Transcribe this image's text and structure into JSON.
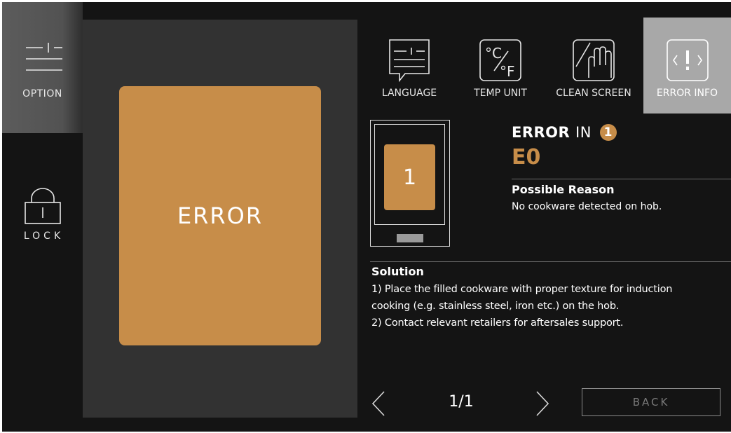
{
  "sidebar": {
    "option_label": "OPTION",
    "lock_label": "LOCK"
  },
  "hob": {
    "zone_status": "ERROR"
  },
  "tabs": [
    {
      "label": "LANGUAGE",
      "icon": "language-icon",
      "active": false
    },
    {
      "label": "TEMP UNIT",
      "icon": "temp-unit-icon",
      "active": false
    },
    {
      "label": "CLEAN SCREEN",
      "icon": "clean-screen-icon",
      "active": false
    },
    {
      "label": "ERROR INFO",
      "icon": "error-info-icon",
      "active": true
    }
  ],
  "error": {
    "title": "ERROR",
    "title_in": "IN",
    "zone_number": "1",
    "code": "E0",
    "map_zone_number": "1",
    "reason_title": "Possible Reason",
    "reason_text": "No cookware detected on hob.",
    "solution_title": "Solution",
    "solution_lines": [
      "1) Place the filled cookware with proper texture for induction",
      "cooking (e.g. stainless steel, iron etc.) on the hob.",
      "2) Contact relevant retailers for aftersales support."
    ]
  },
  "pager": {
    "text": "1/1"
  },
  "back_label": "BACK",
  "colors": {
    "background": "#141414",
    "accent": "#c78d49",
    "hob_panel": "#323232",
    "active_tab": "#a8a8a8"
  }
}
